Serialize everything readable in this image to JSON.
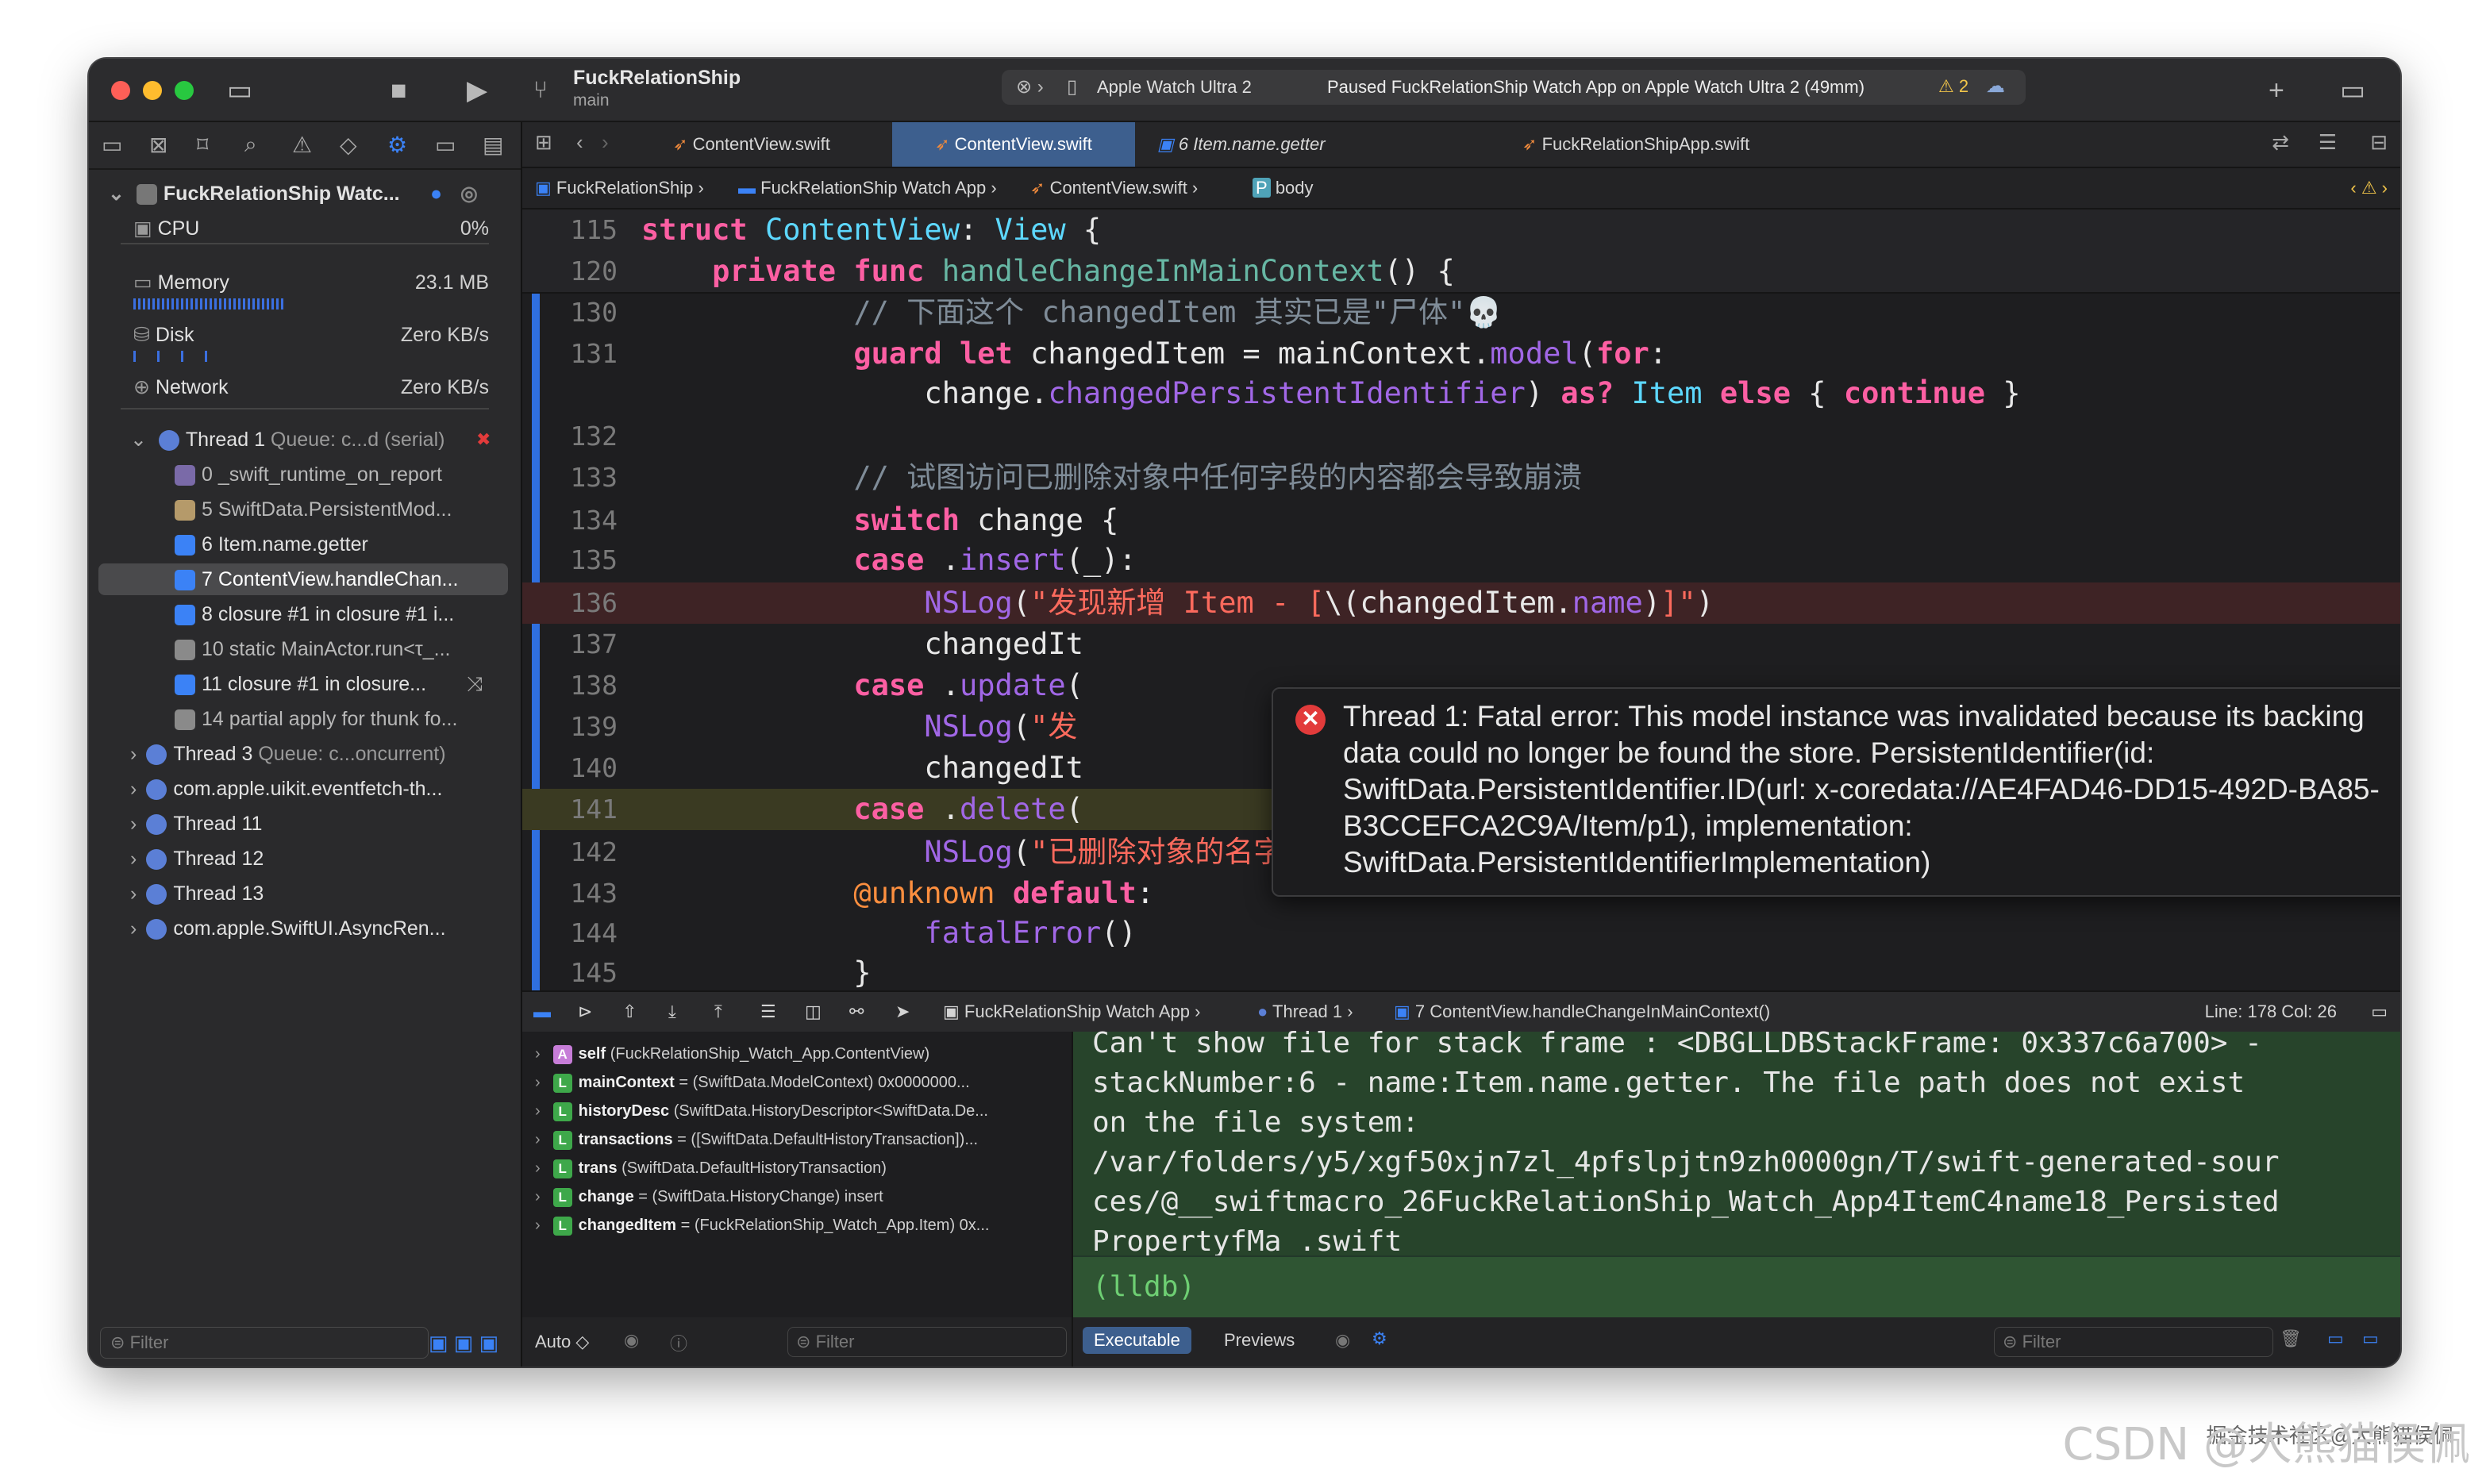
{
  "titlebar": {
    "project": "FuckRelationShip",
    "branch": "main",
    "destination": "Apple Watch Ultra 2",
    "status": "Paused FuckRelationShip Watch App on Apple Watch Ultra 2 (49mm)",
    "warnings": "2"
  },
  "navigator": {
    "process": "FuckRelationShip Watc...",
    "gauges": [
      {
        "label": "CPU",
        "value": "0%"
      },
      {
        "label": "Memory",
        "value": "23.1 MB"
      },
      {
        "label": "Disk",
        "value": "Zero KB/s"
      },
      {
        "label": "Network",
        "value": "Zero KB/s"
      }
    ],
    "thread1": {
      "name": "Thread 1",
      "queue": "Queue: c...d (serial)"
    },
    "frames": [
      "0 _swift_runtime_on_report",
      "5 SwiftData.PersistentMod...",
      "6 Item.name.getter",
      "7 ContentView.handleChan...",
      "8 closure #1 in closure #1 i...",
      "10 static MainActor.run<τ_...",
      "11 closure #1 in closure...",
      "14 partial apply for thunk fo..."
    ],
    "threads": [
      {
        "name": "Thread 3",
        "queue": "Queue: c...oncurrent)"
      },
      {
        "name": "com.apple.uikit.eventfetch-th...",
        "queue": ""
      },
      {
        "name": "Thread 11",
        "queue": ""
      },
      {
        "name": "Thread 12",
        "queue": ""
      },
      {
        "name": "Thread 13",
        "queue": ""
      },
      {
        "name": "com.apple.SwiftUI.AsyncRen...",
        "queue": ""
      }
    ],
    "filter_placeholder": "Filter"
  },
  "tabs": [
    "ContentView.swift",
    "ContentView.swift",
    "6 Item.name.getter",
    "FuckRelationShipApp.swift"
  ],
  "jumpbar": [
    "FuckRelationShip",
    "FuckRelationShip Watch App",
    "ContentView.swift",
    "body"
  ],
  "code": {
    "lines": [
      {
        "n": "115",
        "html": "<span class='kw'>struct</span> <span class='ty'>ContentView</span>: <span class='ty'>View</span> {"
      },
      {
        "n": "120",
        "html": "    <span class='kw'>private</span> <span class='kw'>func</span> <span class='fn'>handleChangeInMainContext</span>() {"
      },
      {
        "n": "130",
        "html": "            <span class='cm'>// 下面这个 changedItem 其实已是\"尸体\"💀</span>"
      },
      {
        "n": "131",
        "html": "            <span class='kw'>guard</span> <span class='kw'>let</span> changedItem = mainContext.<span class='pr'>model</span>(<span class='kw'>for</span>:"
      },
      {
        "n": "",
        "html": "                change.<span class='pr'>changedPersistentIdentifier</span>) <span class='kw'>as?</span> <span class='ty'>Item</span> <span class='kw'>else</span> { <span class='kw'>continue</span> }"
      },
      {
        "n": "132",
        "html": ""
      },
      {
        "n": "133",
        "html": "            <span class='cm'>// 试图访问已删除对象中任何字段的内容都会导致崩溃</span>"
      },
      {
        "n": "134",
        "html": "            <span class='kw'>switch</span> change {"
      },
      {
        "n": "135",
        "html": "            <span class='kw'>case</span> .<span class='pr'>insert</span>(_):"
      },
      {
        "n": "136",
        "html": "                <span class='pr'>NSLog</span>(<span class='st'>\"发现新增 Item - [</span>\\(changedItem.<span class='pr'>name</span>)<span class='st'>]\"</span>)"
      },
      {
        "n": "137",
        "html": "                changedIt"
      },
      {
        "n": "138",
        "html": "            <span class='kw'>case</span> .<span class='pr'>update</span>("
      },
      {
        "n": "139",
        "html": "                <span class='pr'>NSLog</span>(<span class='st'>\"发</span>"
      },
      {
        "n": "140",
        "html": "                changedIt"
      },
      {
        "n": "141",
        "html": "            <span class='kw'>case</span> .<span class='pr'>delete</span>("
      },
      {
        "n": "142",
        "html": "                <span class='pr'>NSLog</span>(<span class='st'>\"已删除对象的名字: </span>\\(changedItem.<span class='pr'>name</span>)<span class='st'>\"</span>)"
      },
      {
        "n": "143",
        "html": "            <span class='at'>@unknown</span> <span class='kw'>default</span>:"
      },
      {
        "n": "144",
        "html": "                <span class='pr'>fatalError</span>()"
      },
      {
        "n": "145",
        "html": "            }"
      }
    ]
  },
  "error": {
    "message": "Thread 1: Fatal error: This model instance was invalidated because its backing data could no longer be found the store. PersistentIdentifier(id: SwiftData.PersistentIdentifier.ID(url: x-coredata://AE4FAD46-DD15-492D-BA85-B3CCEFCA2C9A/Item/p1), implementation: SwiftData.PersistentIdentifierImplementation)"
  },
  "debugbar": {
    "target": "FuckRelationShip Watch App",
    "thread": "Thread 1",
    "frame": "7 ContentView.handleChangeInMainContext()",
    "position": "Line: 178  Col: 26"
  },
  "variables": [
    {
      "badge": "A",
      "name": "self",
      "value": "(FuckRelationShip_Watch_App.ContentView)"
    },
    {
      "badge": "L",
      "name": "mainContext",
      "value": "= (SwiftData.ModelContext) 0x0000000..."
    },
    {
      "badge": "L",
      "name": "historyDesc",
      "value": "(SwiftData.HistoryDescriptor<SwiftData.De..."
    },
    {
      "badge": "L",
      "name": "transactions",
      "value": "= ([SwiftData.DefaultHistoryTransaction])..."
    },
    {
      "badge": "L",
      "name": "trans",
      "value": "(SwiftData.DefaultHistoryTransaction)"
    },
    {
      "badge": "L",
      "name": "change",
      "value": "= (SwiftData.HistoryChange) insert"
    },
    {
      "badge": "L",
      "name": "changedItem",
      "value": "= (FuckRelationShip_Watch_App.Item) 0x..."
    }
  ],
  "variables_footer": {
    "scope": "Auto ◇",
    "filter_placeholder": "Filter"
  },
  "console": {
    "output": "Can't show file for stack frame : <DBGLLDBStackFrame: 0x337c6a700> -\nstackNumber:6 - name:Item.name.getter. The file path does not exist\non the file system:\n/var/folders/y5/xgf50xjn7zl_4pfslpjtn9zh0000gn/T/swift-generated-sour\nces/@__swiftmacro_26FuckRelationShip_Watch_App4ItemC4name18_Persisted\nPropertyfMa_.swift",
    "prompt": "(lldb)",
    "tab_executable": "Executable",
    "tab_previews": "Previews",
    "filter_placeholder": "Filter"
  },
  "watermark": "CSDN @大熊猫侯佩",
  "watermark_small": "掘金技术社区@大熊猫侯佩",
  "colors": {
    "accent": "#3d5f8e",
    "error": "#e23b3b",
    "console_bg": "#27442b"
  }
}
